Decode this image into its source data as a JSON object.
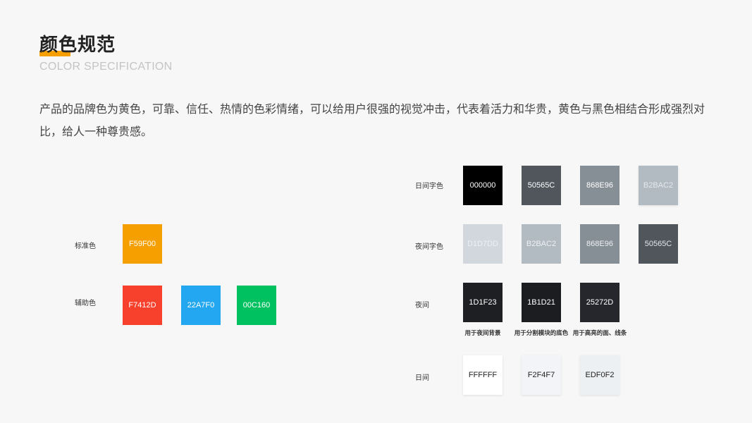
{
  "header": {
    "title": "颜色规范",
    "subtitle": "COLOR SPECIFICATION",
    "underline_color": "#F59F00"
  },
  "description": "产品的品牌色为黄色，可靠、信任、热情的色彩情绪，可以给用户很强的视觉冲击，代表着活力和华贵，黄色与黑色相结合形成强烈对比，给人一种尊贵感。",
  "left_groups": {
    "standard": {
      "label": "标准色",
      "swatches": [
        {
          "hex": "F59F00",
          "color": "#F59F00",
          "text_color": "#FFFFFF"
        }
      ]
    },
    "auxiliary": {
      "label": "辅助色",
      "swatches": [
        {
          "hex": "F7412D",
          "color": "#F7412D",
          "text_color": "#FFFFFF"
        },
        {
          "hex": "22A7F0",
          "color": "#22A7F0",
          "text_color": "#FFFFFF"
        },
        {
          "hex": "00C160",
          "color": "#00C160",
          "text_color": "#FFFFFF"
        }
      ]
    }
  },
  "right_groups": {
    "day_text": {
      "label": "日间字色",
      "swatches": [
        {
          "hex": "000000",
          "color": "#000000",
          "text_color": "#FFFFFF"
        },
        {
          "hex": "50565C",
          "color": "#50565C",
          "text_color": "#FFFFFF"
        },
        {
          "hex": "868E96",
          "color": "#868E96",
          "text_color": "#FFFFFF"
        },
        {
          "hex": "B2BAC2",
          "color": "#B2BAC2",
          "text_color": "#E6EAEE"
        }
      ]
    },
    "night_text": {
      "label": "夜间字色",
      "swatches": [
        {
          "hex": "D1D7DD",
          "color": "#D1D7DD",
          "text_color": "#EEF1F4"
        },
        {
          "hex": "B2BAC2",
          "color": "#B2BAC2",
          "text_color": "#EEF1F4"
        },
        {
          "hex": "868E96",
          "color": "#868E96",
          "text_color": "#EEF1F4"
        },
        {
          "hex": "50565C",
          "color": "#50565C",
          "text_color": "#E6E8EA"
        }
      ]
    },
    "night": {
      "label": "夜间",
      "swatches": [
        {
          "hex": "1D1F23",
          "color": "#1D1F23",
          "text_color": "#FFFFFF",
          "caption": "用于夜间背景"
        },
        {
          "hex": "1B1D21",
          "color": "#1B1D21",
          "text_color": "#FFFFFF",
          "caption": "用于分割模块的底色"
        },
        {
          "hex": "25272D",
          "color": "#25272D",
          "text_color": "#FFFFFF",
          "caption": "用于高亮的面、线条"
        }
      ]
    },
    "day": {
      "label": "日间",
      "swatches": [
        {
          "hex": "FFFFFF",
          "color": "#FFFFFF",
          "text_color": "#222222"
        },
        {
          "hex": "F2F4F7",
          "color": "#F2F4F7",
          "text_color": "#222222"
        },
        {
          "hex": "EDF0F2",
          "color": "#EDF0F2",
          "text_color": "#222222"
        }
      ]
    }
  }
}
